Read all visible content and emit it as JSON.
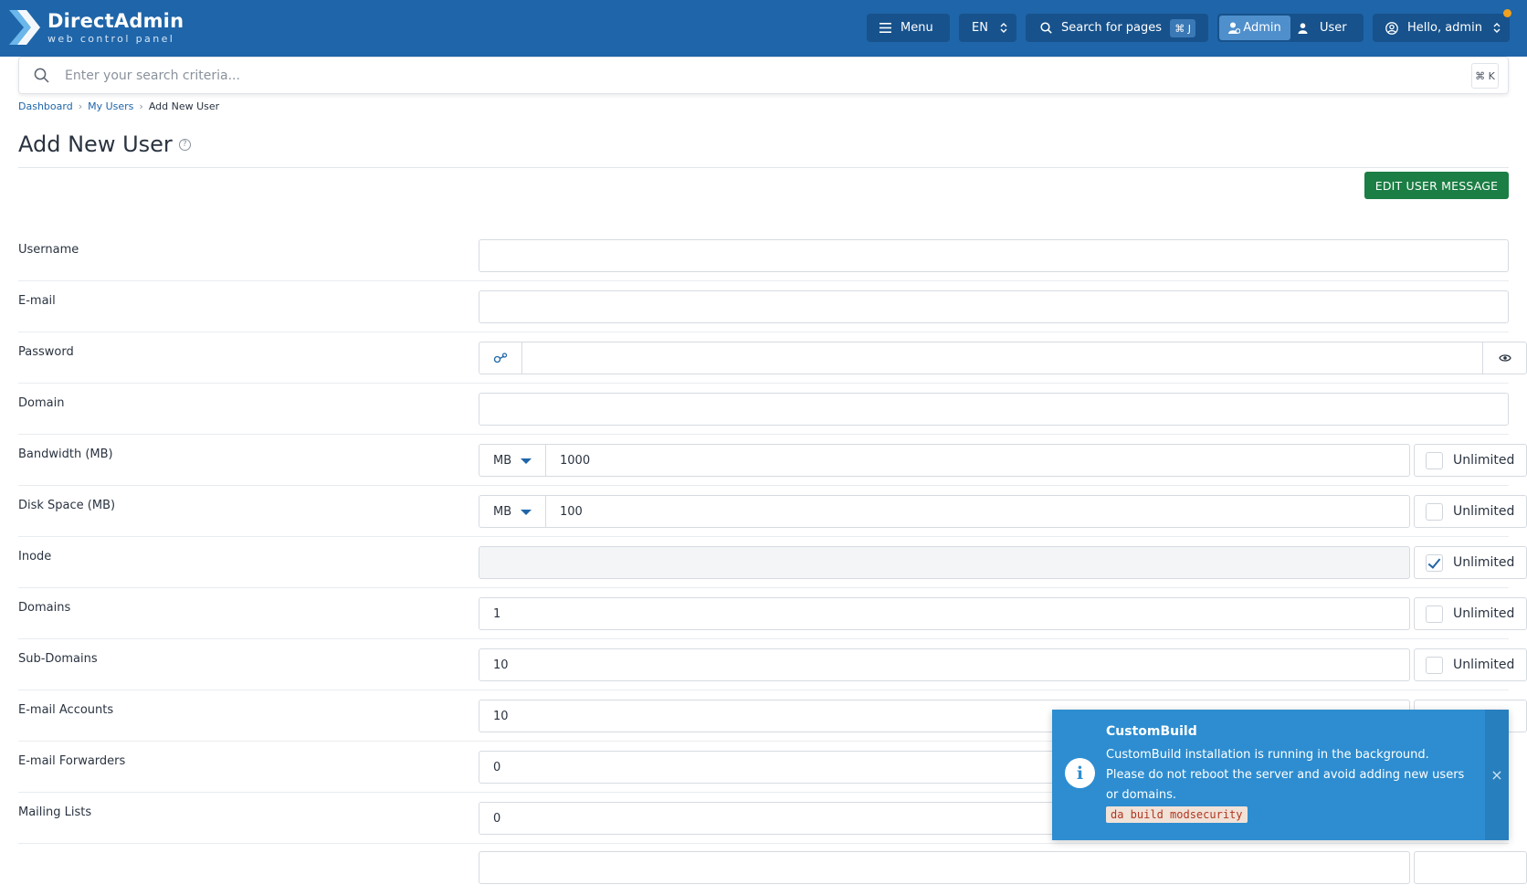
{
  "brand": {
    "title": "DirectAdmin",
    "subtitle": "web control panel"
  },
  "topbar": {
    "menu_label": "Menu",
    "language": "EN",
    "search_label": "Search for pages",
    "search_shortcut": "⌘ J",
    "mode_admin": "Admin",
    "mode_user": "User",
    "greeting": "Hello, admin"
  },
  "search": {
    "placeholder": "Enter your search criteria...",
    "shortcut": "⌘ K"
  },
  "breadcrumb": {
    "items": [
      "Dashboard",
      "My Users",
      "Add New User"
    ]
  },
  "page": {
    "title": "Add New User",
    "edit_message_button": "EDIT USER MESSAGE"
  },
  "form": {
    "unlimited_label": "Unlimited",
    "unit_label": "MB",
    "rows": [
      {
        "label": "Username",
        "value": ""
      },
      {
        "label": "E-mail",
        "value": ""
      },
      {
        "label": "Password",
        "value": ""
      },
      {
        "label": "Domain",
        "value": ""
      },
      {
        "label": "Bandwidth (MB)",
        "value": "1000",
        "unlimited": false
      },
      {
        "label": "Disk Space (MB)",
        "value": "100",
        "unlimited": false
      },
      {
        "label": "Inode",
        "value": "",
        "unlimited": true
      },
      {
        "label": "Domains",
        "value": "1",
        "unlimited": false
      },
      {
        "label": "Sub-Domains",
        "value": "10",
        "unlimited": false
      },
      {
        "label": "E-mail Accounts",
        "value": "10"
      },
      {
        "label": "E-mail Forwarders",
        "value": "0"
      },
      {
        "label": "Mailing Lists",
        "value": "0"
      }
    ]
  },
  "toast": {
    "title": "CustomBuild",
    "body": "CustomBuild installation is running in the background. Please do not reboot the server and avoid adding new users or domains.",
    "code": "da build modsecurity",
    "close": "×"
  },
  "colors": {
    "topbar": "#1f65a9",
    "accent": "#1f65a9",
    "primary_button": "#1b7e44",
    "toast": "#2d8dd0",
    "notification_dot": "#f0a01e"
  }
}
